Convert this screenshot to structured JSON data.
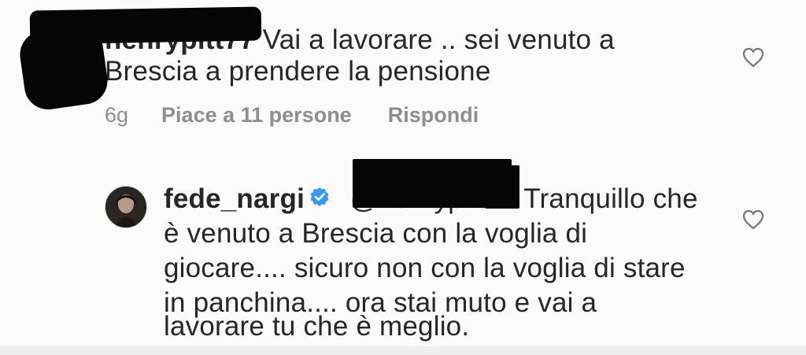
{
  "comment1": {
    "username": "henrypitt77",
    "text_line1": "Vai a lavorare .. sei venuto a",
    "text_line2": "Brescia a prendere la pensione",
    "time": "6g",
    "likes": "Piace a 11 persone",
    "reply": "Rispondi"
  },
  "reply1": {
    "username": "fede_nargi",
    "mention": "@henrypitt77",
    "text_line1": "Tranquillo che",
    "text_line2": "è venuto a Brescia con la voglia di",
    "text_line3": "giocare.... sicuro non con la voglia di stare",
    "text_line4": "in panchina.... ora stai muto e vai a",
    "text_line5": "lavorare tu che è meglio."
  },
  "icons": {
    "comment1_like": "heart-outline-icon",
    "reply1_like": "heart-outline-icon",
    "verified": "verified-badge-icon"
  },
  "colors": {
    "text": "#262626",
    "meta": "#8e8e8e",
    "verified": "#3897f0",
    "background": "#fbfbfb"
  }
}
